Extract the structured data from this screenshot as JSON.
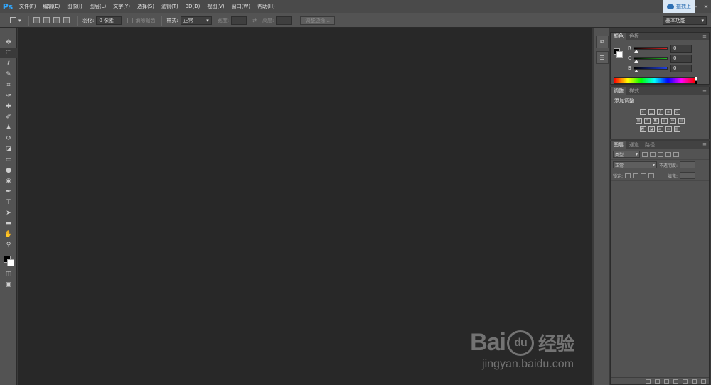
{
  "app": {
    "logo_text": "Ps"
  },
  "menu": {
    "items": [
      "文件(F)",
      "编辑(E)",
      "图像(I)",
      "图层(L)",
      "文字(Y)",
      "选择(S)",
      "滤镜(T)",
      "3D(D)",
      "视图(V)",
      "窗口(W)",
      "帮助(H)"
    ]
  },
  "window": {
    "minimize": "–",
    "maximize": "□",
    "close": "✕",
    "cloud_badge": "拖拽上"
  },
  "options": {
    "feather_label": "羽化:",
    "feather_value": "0 像素",
    "antialias_label": "消除锯齿",
    "style_label": "样式:",
    "style_value": "正常",
    "width_label": "宽度:",
    "height_label": "高度:",
    "refine_edge": "调整边缘...",
    "workspace": "基本功能"
  },
  "toolbox": {
    "tools": [
      {
        "name": "move-tool-icon",
        "glyph": "✥"
      },
      {
        "name": "marquee-tool-icon",
        "glyph": "⬚"
      },
      {
        "name": "lasso-tool-icon",
        "glyph": "ℓ"
      },
      {
        "name": "quick-select-tool-icon",
        "glyph": "✎"
      },
      {
        "name": "crop-tool-icon",
        "glyph": "⌗"
      },
      {
        "name": "eyedropper-tool-icon",
        "glyph": "✑"
      },
      {
        "name": "healing-brush-tool-icon",
        "glyph": "✚"
      },
      {
        "name": "brush-tool-icon",
        "glyph": "✐"
      },
      {
        "name": "clone-stamp-tool-icon",
        "glyph": "♟"
      },
      {
        "name": "history-brush-tool-icon",
        "glyph": "↺"
      },
      {
        "name": "eraser-tool-icon",
        "glyph": "◪"
      },
      {
        "name": "gradient-tool-icon",
        "glyph": "▭"
      },
      {
        "name": "blur-tool-icon",
        "glyph": "●"
      },
      {
        "name": "dodge-tool-icon",
        "glyph": "◉"
      },
      {
        "name": "pen-tool-icon",
        "glyph": "✒"
      },
      {
        "name": "type-tool-icon",
        "glyph": "T"
      },
      {
        "name": "path-select-tool-icon",
        "glyph": "➤"
      },
      {
        "name": "shape-tool-icon",
        "glyph": "▬"
      },
      {
        "name": "hand-tool-icon",
        "glyph": "✋"
      },
      {
        "name": "zoom-tool-icon",
        "glyph": "⚲"
      }
    ],
    "quickmask_glyph": "◫",
    "screenmode_glyph": "▣"
  },
  "dock": {
    "history_glyph": "⧉",
    "properties_glyph": "☰"
  },
  "panels": {
    "color_tabs": [
      "颜色",
      "色板"
    ],
    "adjust_tabs": [
      "调整",
      "样式"
    ],
    "layers_tabs": [
      "图层",
      "通道",
      "路径"
    ],
    "menu_glyph": "≡",
    "rgb": [
      {
        "label": "R",
        "value": "0",
        "color": "#e02020"
      },
      {
        "label": "G",
        "value": "0",
        "color": "#20c020"
      },
      {
        "label": "B",
        "value": "0",
        "color": "#2040e0"
      }
    ],
    "adjust_title": "添加调整",
    "layer_filter": "类型",
    "blend_mode": "正常",
    "opacity_label": "不透明度:",
    "lock_label": "锁定:",
    "fill_label": "填充:"
  },
  "watermark": {
    "logo_a": "Bai",
    "logo_paw": "du",
    "logo_cn": "经验",
    "url": "jingyan.baidu.com"
  },
  "colors": {
    "accent": "#31a8ff",
    "canvas": "#282828",
    "panel": "#535353"
  }
}
